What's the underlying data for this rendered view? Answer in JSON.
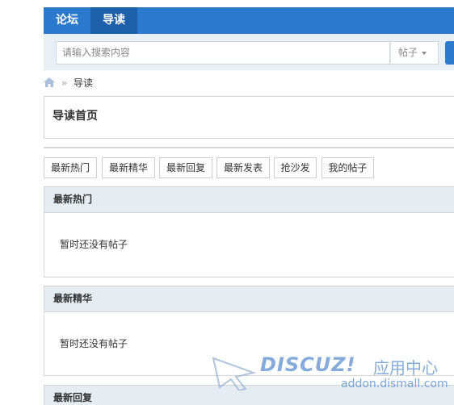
{
  "nav": {
    "tabs": [
      "论坛",
      "导读"
    ]
  },
  "search": {
    "placeholder": "请输入搜索内容",
    "type": "帖子"
  },
  "breadcrumb": {
    "current": "导读"
  },
  "page": {
    "title": "导读首页"
  },
  "filter_tabs": [
    "最新热门",
    "最新精华",
    "最新回复",
    "最新发表",
    "抢沙发",
    "我的帖子"
  ],
  "sections": [
    {
      "title": "最新热门",
      "empty": "暂时还没有帖子"
    },
    {
      "title": "最新精华",
      "empty": "暂时还没有帖子"
    },
    {
      "title": "最新回复"
    }
  ],
  "watermark": {
    "brand": "DISCUZ!",
    "cn": "应用中心",
    "url": "addon.dismall.com"
  },
  "colors": {
    "nav": "#2b7acd",
    "nav_active": "#1d5fa8",
    "section_header": "#e5edf2",
    "watermark": "#5b8fd0"
  }
}
